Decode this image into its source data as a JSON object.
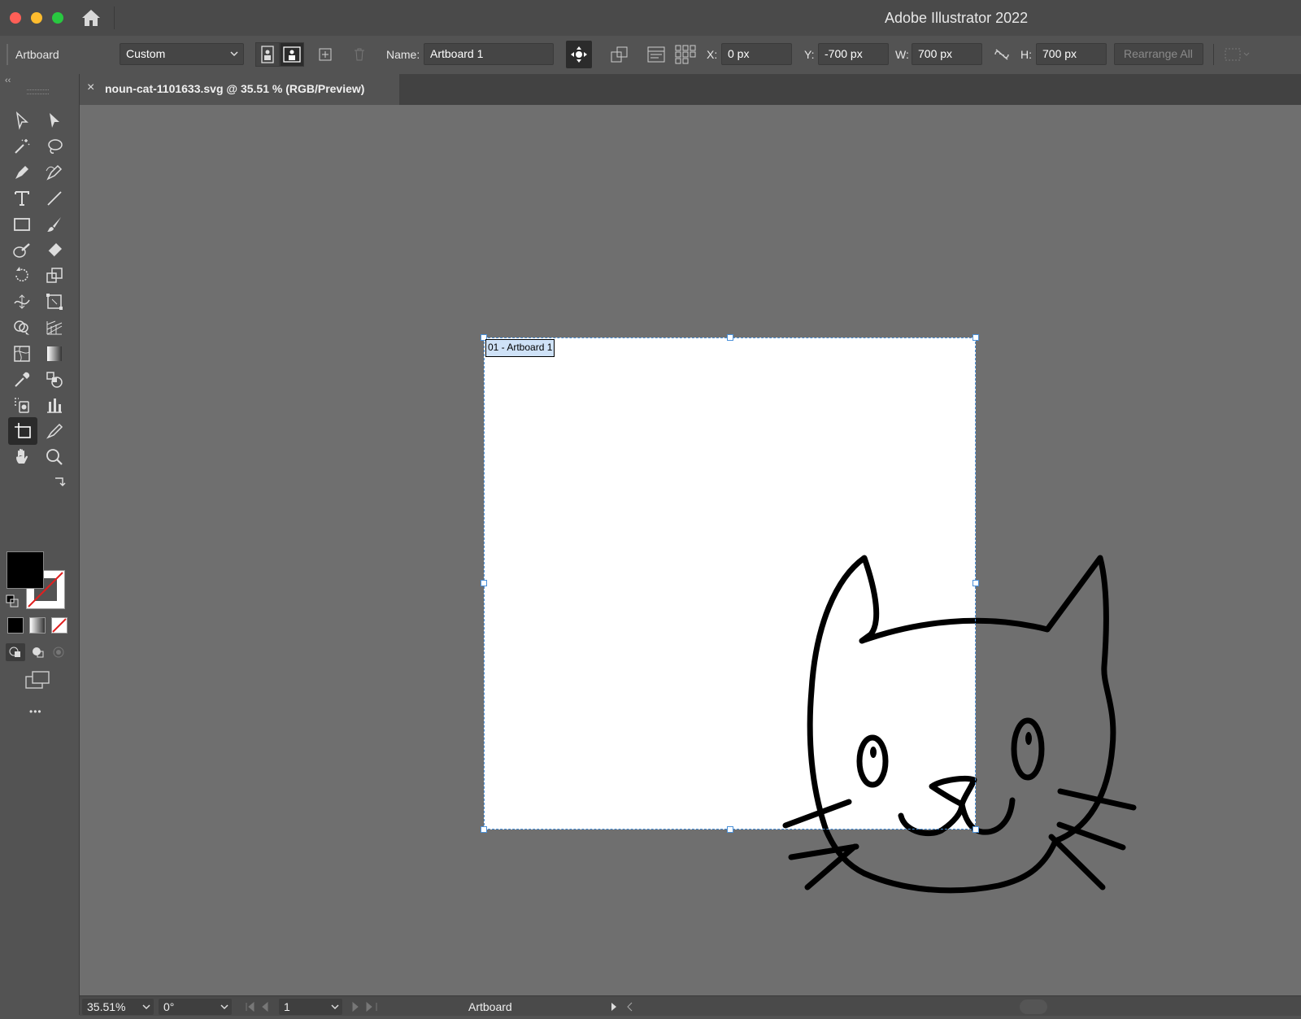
{
  "window": {
    "title": "Adobe Illustrator 2022",
    "traffic_lights": [
      "#ff5f57",
      "#febc2e",
      "#28c840"
    ]
  },
  "control_bar": {
    "mode_label": "Artboard",
    "preset_value": "Custom",
    "name_label": "Name:",
    "name_value": "Artboard 1",
    "x_label": "X:",
    "x_value": "0 px",
    "y_label": "Y:",
    "y_value": "-700 px",
    "w_label": "W:",
    "w_value": "700 px",
    "h_label": "H:",
    "h_value": "700 px",
    "rearrange_label": "Rearrange All"
  },
  "document_tab": {
    "close_glyph": "×",
    "title": "noun-cat-1101633.svg @ 35.51 % (RGB/Preview)"
  },
  "canvas": {
    "artboard_label": "01 - Artboard 1",
    "selection_color": "#4a90d9"
  },
  "tools_panel": {
    "more_glyph": "•••",
    "fill_color": "#000000",
    "stroke_color": "none"
  },
  "status_bar": {
    "zoom": "35.51%",
    "rotation": "0°",
    "artboard_number": "1",
    "tool_label": "Artboard"
  }
}
